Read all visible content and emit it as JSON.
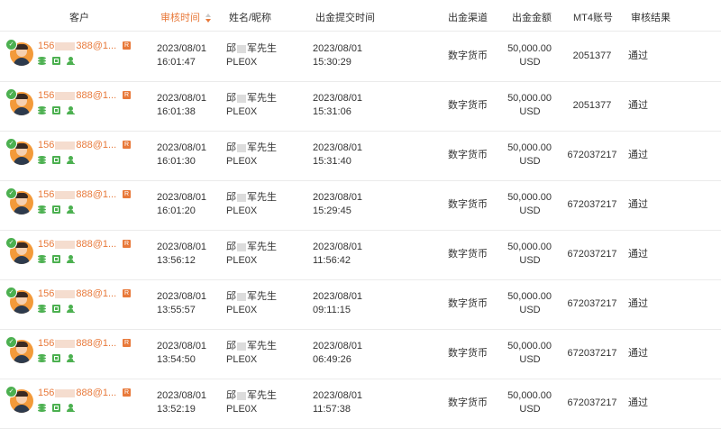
{
  "header": {
    "customer": "客户",
    "review_time": "审核时间",
    "name": "姓名/昵称",
    "submit_time": "出金提交时间",
    "channel": "出金渠道",
    "amount": "出金金额",
    "mt4": "MT4账号",
    "result": "审核结果"
  },
  "colors": {
    "accent": "#e8793a",
    "green": "#4cb050"
  },
  "rows": [
    {
      "id_prefix": "156",
      "id_suffix": "388@1...",
      "badge": "R",
      "review_date": "2023/08/01",
      "review_time": "16:01:47",
      "name_prefix": "邱",
      "name_suffix": "军先生",
      "nick": "PLE0X",
      "submit_date": "2023/08/01",
      "submit_time": "15:30:29",
      "channel": "数字货币",
      "amount": "50,000.00",
      "currency": "USD",
      "mt4": "2051377",
      "result": "通过"
    },
    {
      "id_prefix": "156",
      "id_suffix": "888@1...",
      "badge": "R",
      "review_date": "2023/08/01",
      "review_time": "16:01:38",
      "name_prefix": "邱",
      "name_suffix": "军先生",
      "nick": "PLE0X",
      "submit_date": "2023/08/01",
      "submit_time": "15:31:06",
      "channel": "数字货币",
      "amount": "50,000.00",
      "currency": "USD",
      "mt4": "2051377",
      "result": "通过"
    },
    {
      "id_prefix": "156",
      "id_suffix": "888@1...",
      "badge": "R",
      "review_date": "2023/08/01",
      "review_time": "16:01:30",
      "name_prefix": "邱",
      "name_suffix": "军先生",
      "nick": "PLE0X",
      "submit_date": "2023/08/01",
      "submit_time": "15:31:40",
      "channel": "数字货币",
      "amount": "50,000.00",
      "currency": "USD",
      "mt4": "672037217",
      "result": "通过"
    },
    {
      "id_prefix": "156",
      "id_suffix": "888@1...",
      "badge": "R",
      "review_date": "2023/08/01",
      "review_time": "16:01:20",
      "name_prefix": "邱",
      "name_suffix": "军先生",
      "nick": "PLE0X",
      "submit_date": "2023/08/01",
      "submit_time": "15:29:45",
      "channel": "数字货币",
      "amount": "50,000.00",
      "currency": "USD",
      "mt4": "672037217",
      "result": "通过"
    },
    {
      "id_prefix": "156",
      "id_suffix": "888@1...",
      "badge": "R",
      "review_date": "2023/08/01",
      "review_time": "13:56:12",
      "name_prefix": "邱",
      "name_suffix": "军先生",
      "nick": "PLE0X",
      "submit_date": "2023/08/01",
      "submit_time": "11:56:42",
      "channel": "数字货币",
      "amount": "50,000.00",
      "currency": "USD",
      "mt4": "672037217",
      "result": "通过"
    },
    {
      "id_prefix": "156",
      "id_suffix": "888@1...",
      "badge": "R",
      "review_date": "2023/08/01",
      "review_time": "13:55:57",
      "name_prefix": "邱",
      "name_suffix": "军先生",
      "nick": "PLE0X",
      "submit_date": "2023/08/01",
      "submit_time": "09:11:15",
      "channel": "数字货币",
      "amount": "50,000.00",
      "currency": "USD",
      "mt4": "672037217",
      "result": "通过"
    },
    {
      "id_prefix": "156",
      "id_suffix": "888@1...",
      "badge": "R",
      "review_date": "2023/08/01",
      "review_time": "13:54:50",
      "name_prefix": "邱",
      "name_suffix": "军先生",
      "nick": "PLE0X",
      "submit_date": "2023/08/01",
      "submit_time": "06:49:26",
      "channel": "数字货币",
      "amount": "50,000.00",
      "currency": "USD",
      "mt4": "672037217",
      "result": "通过"
    },
    {
      "id_prefix": "156",
      "id_suffix": "888@1...",
      "badge": "R",
      "review_date": "2023/08/01",
      "review_time": "13:52:19",
      "name_prefix": "邱",
      "name_suffix": "军先生",
      "nick": "PLE0X",
      "submit_date": "2023/08/01",
      "submit_time": "11:57:38",
      "channel": "数字货币",
      "amount": "50,000.00",
      "currency": "USD",
      "mt4": "672037217",
      "result": "通过"
    }
  ]
}
